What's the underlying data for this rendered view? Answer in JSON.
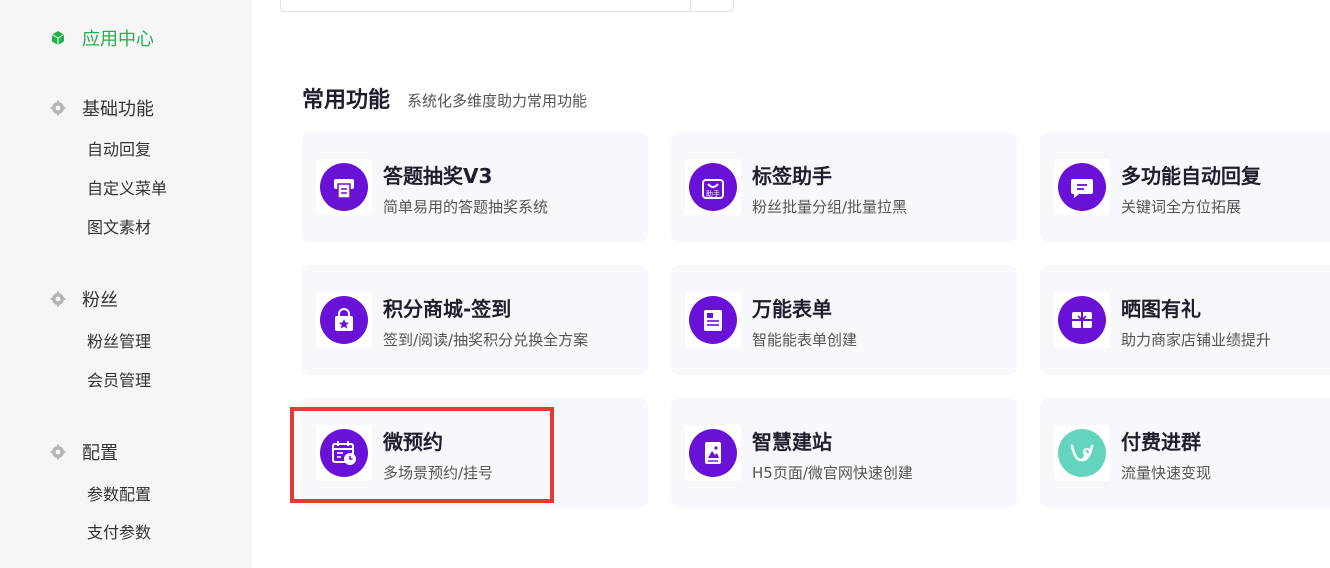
{
  "sidebar": {
    "active_item": "应用中心",
    "groups": [
      {
        "label": "基础功能",
        "items": [
          "自动回复",
          "自定义菜单",
          "图文素材"
        ]
      },
      {
        "label": "粉丝",
        "items": [
          "粉丝管理",
          "会员管理"
        ]
      },
      {
        "label": "配置",
        "items": [
          "参数配置",
          "支付参数"
        ]
      }
    ]
  },
  "section": {
    "title": "常用功能",
    "subtitle": "系统化多维度助力常用功能"
  },
  "cards": [
    {
      "title": "答题抽奖V3",
      "desc": "简单易用的答题抽奖系统",
      "icon": "printer-icon"
    },
    {
      "title": "标签助手",
      "desc": "粉丝批量分组/批量拉黑",
      "icon": "bag-helper-icon",
      "icon_text": "助手"
    },
    {
      "title": "多功能自动回复",
      "desc": "关键词全方位拓展",
      "icon": "chat-bubble-icon"
    },
    {
      "title": "积分商城-签到",
      "desc": "签到/阅读/抽奖积分兑换全方案",
      "icon": "shopping-bag-star-icon"
    },
    {
      "title": "万能表单",
      "desc": "智能能表单创建",
      "icon": "form-icon"
    },
    {
      "title": "晒图有礼",
      "desc": "助力商家店铺业绩提升",
      "icon": "gift-icon"
    },
    {
      "title": "微预约",
      "desc": "多场景预约/挂号",
      "icon": "calendar-clock-icon"
    },
    {
      "title": "智慧建站",
      "desc": "H5页面/微官网快速创建",
      "icon": "document-image-icon"
    },
    {
      "title": "付费进群",
      "desc": "流量快速变现",
      "icon": "v-logo-icon"
    }
  ],
  "colors": {
    "accent_green": "#22b14c",
    "icon_purple": "#6a11d8",
    "icon_mint": "#64d4be",
    "highlight_red": "#e53935"
  }
}
